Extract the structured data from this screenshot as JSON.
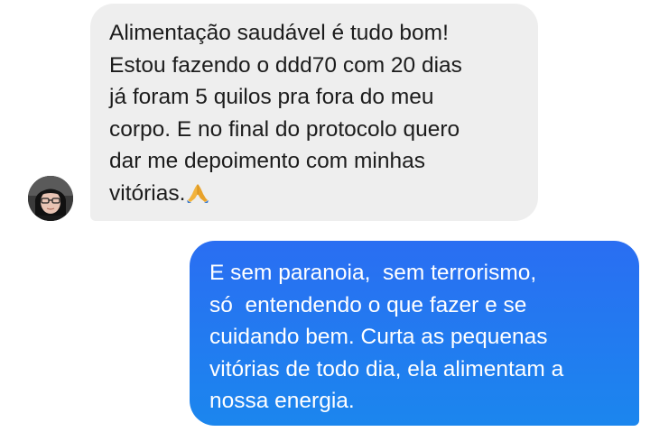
{
  "conversation": {
    "incoming": {
      "lines": [
        "Alimentação saudável é tudo bom!",
        "Estou fazendo o ddd70 com 20 dias",
        "já foram 5 quilos pra fora do meu",
        "corpo. E no final do protocolo quero",
        "dar me depoimento com minhas",
        "vitórias."
      ],
      "emoji_icon": "praying-hands-icon",
      "sender_avatar": "sender-avatar"
    },
    "outgoing": {
      "lines": [
        "E sem paranoia,  sem terrorismo,",
        "só  entendendo o que fazer e se",
        "cuidando bem. Curta as pequenas",
        "vitórias de todo dia, ela alimentam a",
        "nossa energia."
      ]
    }
  },
  "colors": {
    "incoming_bubble": "#eeeeee",
    "outgoing_bubble": "#1e7bf0",
    "incoming_text": "#1c1c1c",
    "outgoing_text": "#ffffff"
  }
}
